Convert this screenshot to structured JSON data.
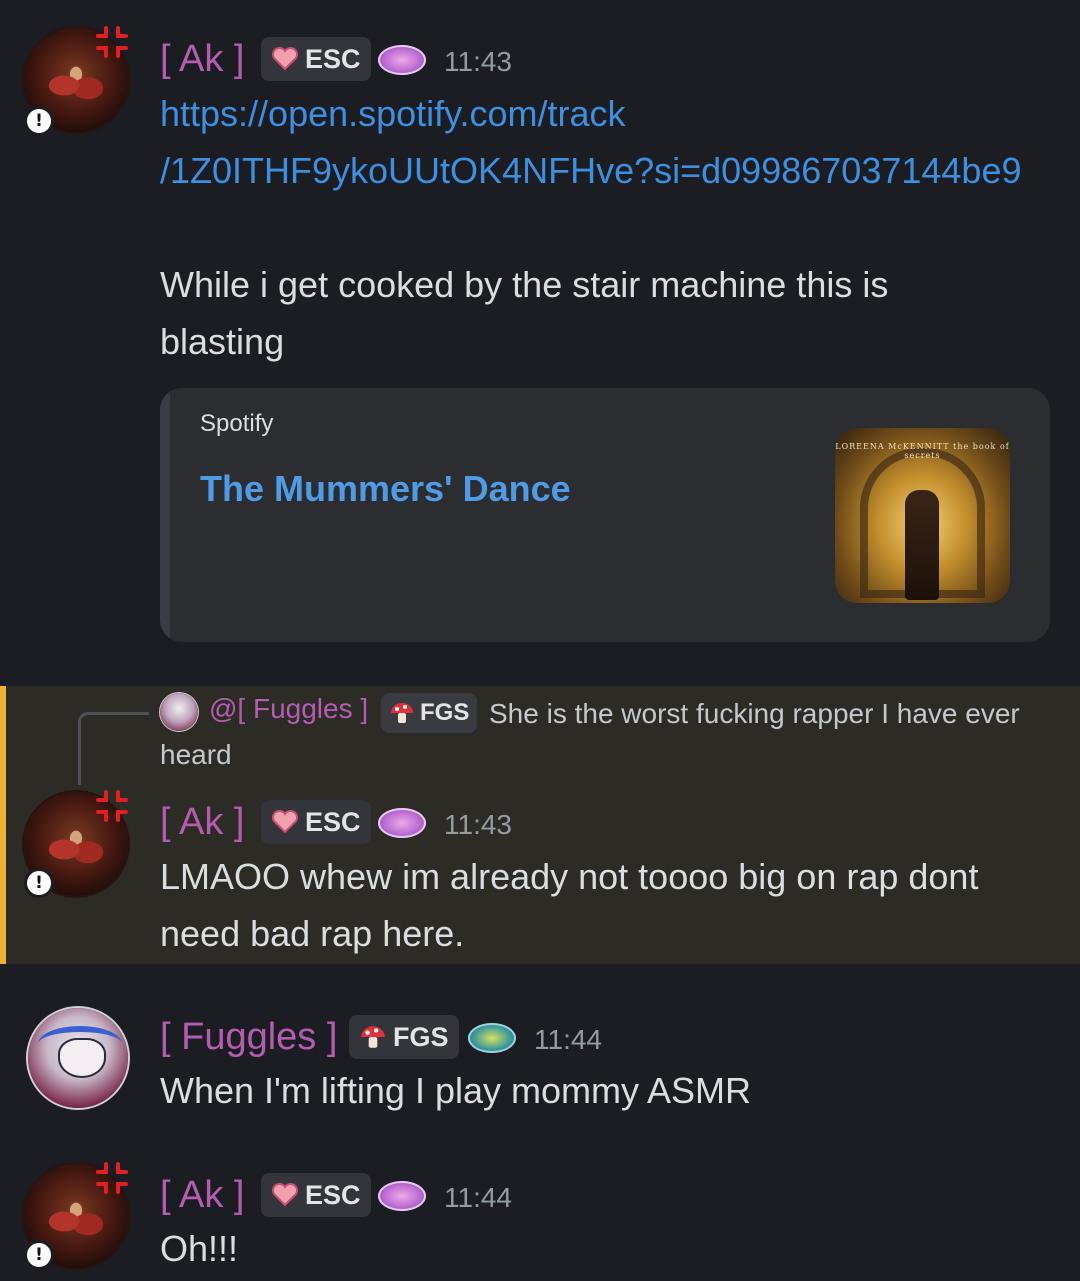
{
  "messages": [
    {
      "author": "[ Ak ]",
      "tag": "ESC",
      "time": "11:43",
      "link_line1": "https://open.spotify.com/track",
      "link_line2": "/1Z0ITHF9ykoUUtOK4NFHve?si=d099867037144be9",
      "text_line1": "While i get cooked by the stair machine this is",
      "text_line2": "blasting"
    },
    {
      "author": "[ Ak ]",
      "tag": "ESC",
      "time": "11:43",
      "text_line1": "LMAOO whew im already not toooo big on rap dont",
      "text_line2": "need bad rap here."
    },
    {
      "author": "[ Fuggles ]",
      "tag": "FGS",
      "time": "11:44",
      "text_line1": "When I'm lifting I play mommy ASMR"
    },
    {
      "author": "[ Ak ]",
      "tag": "ESC",
      "time": "11:44",
      "text_line1": "Oh!!!"
    }
  ],
  "embed": {
    "provider": "Spotify",
    "title": "The Mummers' Dance",
    "cover_text": "LOREENA McKENNITT the book of secrets"
  },
  "reply": {
    "author": "@[ Fuggles ]",
    "tag": "FGS",
    "text": "She is the worst fucking rapper I have ever heard"
  },
  "status_badge_symbol": "!",
  "colors": {
    "background": "#1c1d22",
    "username": "#b45db0",
    "link": "#3d8fe0",
    "highlight_border": "#f0b232",
    "highlight_bg": "#2d2b25"
  }
}
